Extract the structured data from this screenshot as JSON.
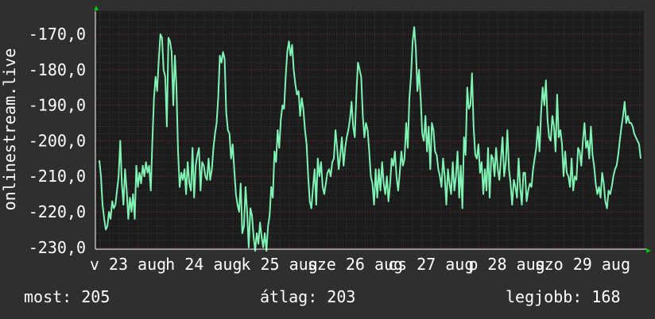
{
  "chart_data": {
    "type": "line",
    "ylabel": "onlinestream.live",
    "y_ticks": [
      -170,
      -180,
      -190,
      -200,
      -210,
      -220,
      -230
    ],
    "y_tick_labels": [
      "-170,0",
      "-180,0",
      "-190,0",
      "-200,0",
      "-210,0",
      "-220,0",
      "-230,0"
    ],
    "ylim": [
      -230.5,
      -163.5
    ],
    "x_tick_labels": [
      "v 23 aug",
      "h 24 aug",
      "k 25 aug",
      "sze 26 aug",
      "cs 27 aug",
      "p 28 aug",
      "szo 29 aug"
    ],
    "grid": true,
    "line_color": "#7ff2b4",
    "series": [
      {
        "values": [
          -205.5,
          -210,
          -218,
          -222,
          -225,
          -224,
          -220,
          -222,
          -217,
          -219,
          -218,
          -214,
          -210,
          -200,
          -212,
          -218,
          -208,
          -214,
          -222,
          -216,
          -220,
          -215,
          -222,
          -207,
          -213,
          -209,
          -212,
          -207,
          -210,
          -206,
          -209,
          -207,
          -214,
          -200,
          -188,
          -182,
          -186,
          -177,
          -170,
          -171,
          -180,
          -182,
          -196,
          -171,
          -172,
          -175,
          -190,
          -176,
          -185,
          -203,
          -213,
          -209,
          -211,
          -208,
          -215,
          -206,
          -212,
          -214,
          -202,
          -216,
          -207,
          -204,
          -202,
          -214,
          -206,
          -207,
          -210,
          -211,
          -205,
          -211,
          -208,
          -202,
          -198,
          -195,
          -188,
          -176,
          -178,
          -175,
          -177,
          -192,
          -197,
          -198,
          -205,
          -201,
          -208,
          -215,
          -218,
          -220,
          -212,
          -226,
          -224,
          -213,
          -220,
          -230,
          -219,
          -221,
          -227,
          -231,
          -226,
          -229,
          -223,
          -227,
          -230,
          -226,
          -231,
          -224,
          -221,
          -213,
          -216,
          -203,
          -206,
          -197,
          -202,
          -194,
          -190,
          -191,
          -182,
          -175,
          -172,
          -176,
          -173,
          -180,
          -184,
          -187,
          -186,
          -193,
          -188,
          -191,
          -197,
          -201,
          -210,
          -217,
          -219,
          -213,
          -208,
          -218,
          -205,
          -210,
          -206,
          -213,
          -215,
          -212,
          -209,
          -208,
          -210,
          -206,
          -205,
          -197,
          -202,
          -208,
          -204,
          -199,
          -207,
          -202,
          -199,
          -197,
          -194,
          -189,
          -196,
          -199,
          -187,
          -178,
          -180,
          -182,
          -193,
          -199,
          -195,
          -197,
          -203,
          -210,
          -212,
          -218,
          -208,
          -216,
          -208,
          -214,
          -206,
          -212,
          -215,
          -210,
          -217,
          -212,
          -205,
          -207,
          -203,
          -210,
          -214,
          -209,
          -203,
          -207,
          -205,
          -195,
          -202,
          -188,
          -182,
          -172,
          -168,
          -174,
          -186,
          -180,
          -188,
          -198,
          -200,
          -193,
          -203,
          -196,
          -208,
          -195,
          -197,
          -203,
          -204,
          -208,
          -210,
          -213,
          -205,
          -210,
          -218,
          -208,
          -212,
          -215,
          -206,
          -214,
          -210,
          -203,
          -216,
          -207,
          -219,
          -199,
          -204,
          -185,
          -191,
          -190,
          -181,
          -196,
          -204,
          -205,
          -201,
          -209,
          -206,
          -215,
          -208,
          -214,
          -202,
          -216,
          -204,
          -205,
          -210,
          -202,
          -208,
          -211,
          -205,
          -199,
          -210,
          -206,
          -197,
          -208,
          -212,
          -218,
          -211,
          -213,
          -216,
          -205,
          -213,
          -218,
          -209,
          -209,
          -217,
          -214,
          -212,
          -213,
          -208,
          -205,
          -202,
          -196,
          -203,
          -192,
          -185,
          -190,
          -183,
          -194,
          -199,
          -200,
          -193,
          -196,
          -203,
          -187,
          -199,
          -197,
          -201,
          -210,
          -203,
          -209,
          -210,
          -213,
          -205,
          -214,
          -210,
          -211,
          -202,
          -203,
          -207,
          -200,
          -195,
          -202,
          -200,
          -205,
          -196,
          -204,
          -207,
          -212,
          -215,
          -213,
          -216,
          -209,
          -212,
          -217,
          -219,
          -214,
          -215,
          -213,
          -210,
          -208,
          -207,
          -204,
          -200,
          -196,
          -193,
          -189,
          -195,
          -193,
          -195,
          -195,
          -196,
          -198,
          -199,
          -200,
          -201,
          -205
        ]
      }
    ]
  },
  "footer": {
    "current_label": "most:",
    "current_value": "205",
    "average_label": "átlag:",
    "average_value": "203",
    "best_label": "legjobb:",
    "best_value": "168"
  }
}
